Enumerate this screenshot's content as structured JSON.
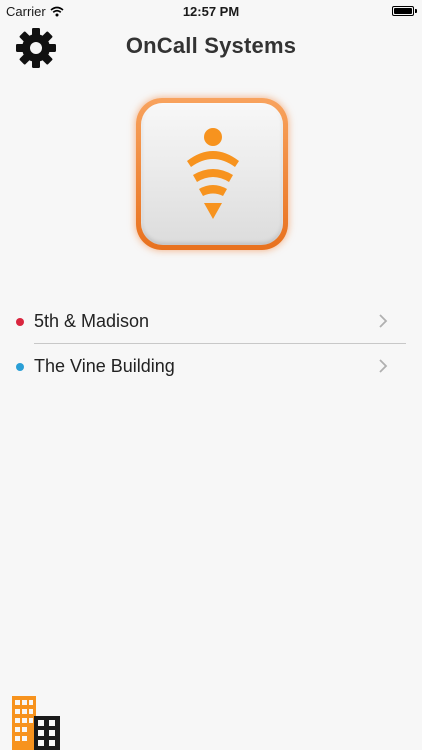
{
  "status_bar": {
    "carrier": "Carrier",
    "time": "12:57 PM"
  },
  "header": {
    "title": "OnCall Systems",
    "settings_icon": "gear-icon"
  },
  "logo": {
    "icon": "oncall-signal-logo",
    "accent_color": "#f7931e",
    "border_color": "#ee7d2c"
  },
  "locations": [
    {
      "name": "5th & Madison",
      "dot_color": "#d9263f"
    },
    {
      "name": "The Vine Building",
      "dot_color": "#2a9fd6"
    }
  ],
  "footer": {
    "icon": "buildings-icon",
    "colors": [
      "#f7931e",
      "#1a1a1a"
    ]
  }
}
